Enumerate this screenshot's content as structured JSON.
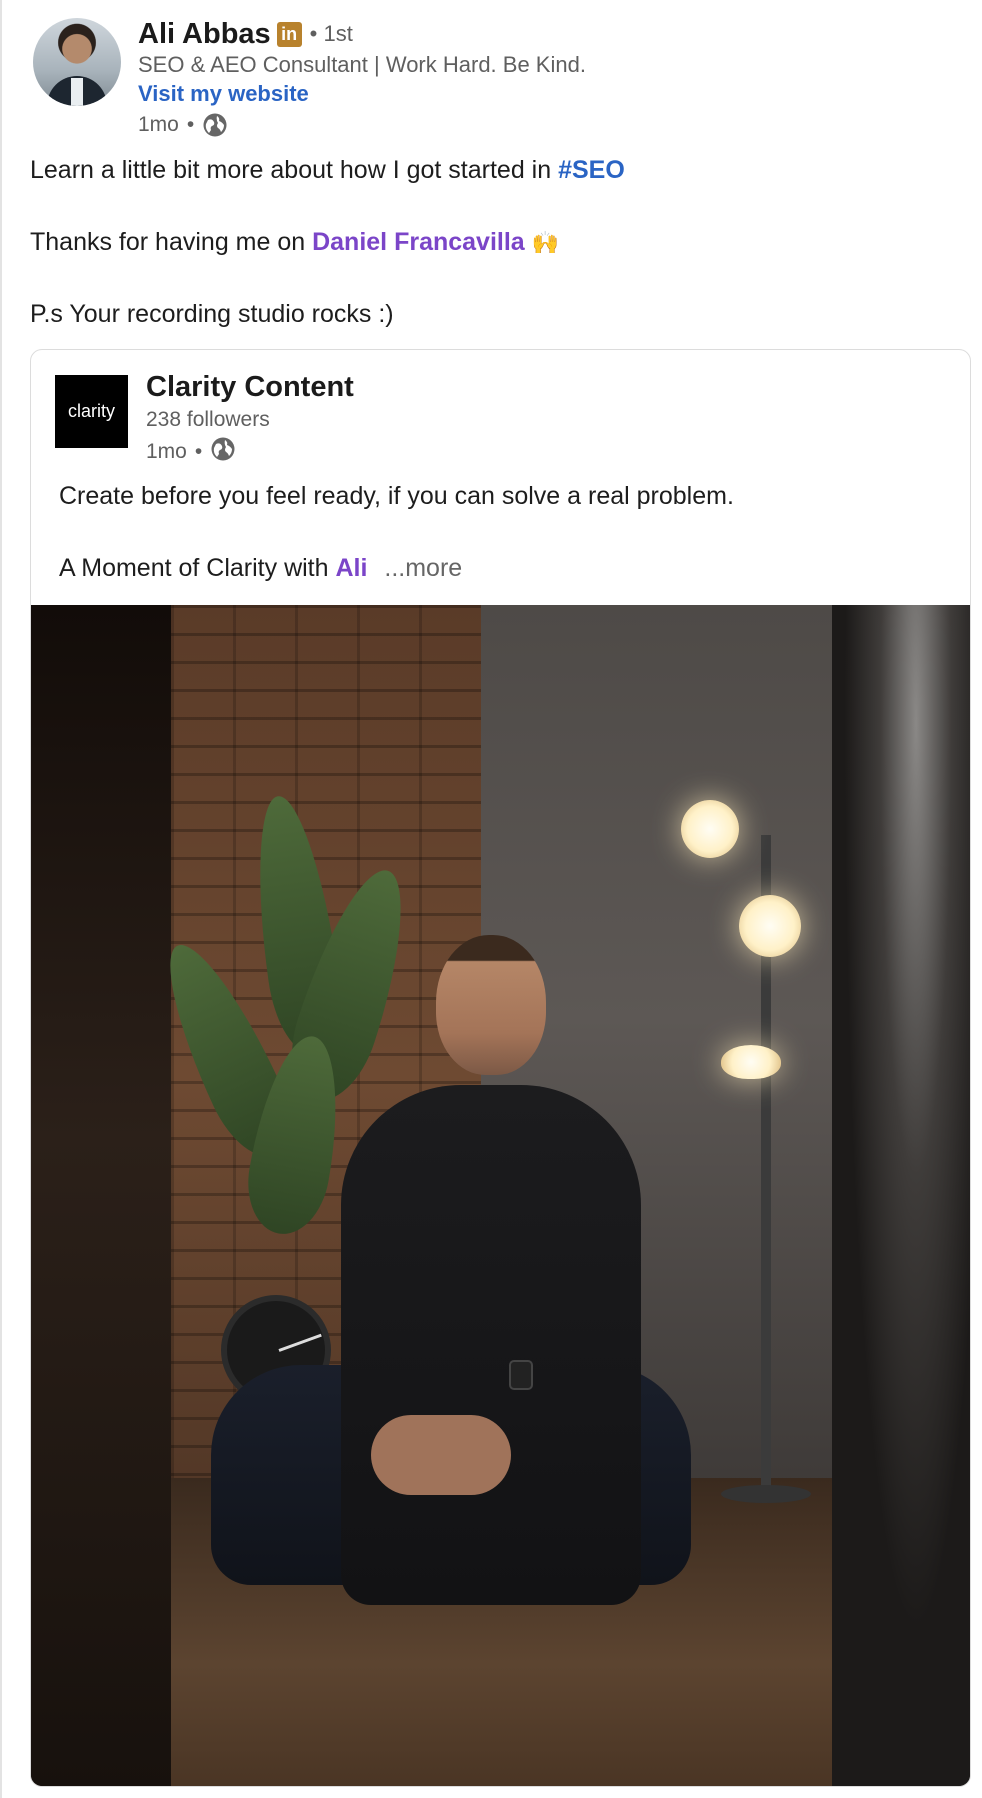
{
  "post": {
    "author": {
      "name": "Ali Abbas",
      "badge": "in",
      "degree": "• 1st",
      "headline": "SEO & AEO Consultant | Work Hard. Be Kind.",
      "website_label": "Visit my website",
      "time": "1mo",
      "dot": "•",
      "visibility_icon": "globe-icon"
    },
    "text": {
      "line1_prefix": "Learn a little bit more about how I got started in ",
      "hashtag": "#SEO",
      "line2_prefix": "Thanks for having me on ",
      "mention": "Daniel Francavilla",
      "emoji": "🙌",
      "line3": "P.s Your recording studio rocks :)"
    },
    "shared": {
      "company_logo_text": "clarity",
      "company_name": "Clarity Content",
      "followers": "238 followers",
      "time": "1mo",
      "dot": "•",
      "visibility_icon": "globe-icon",
      "line1": "Create before you feel ready, if you can solve a real problem.",
      "line2_prefix": "A Moment of Clarity with ",
      "mention": "Ali",
      "more_label": "...more"
    }
  },
  "colors": {
    "link_blue": "#2a64c4",
    "mention_purple": "#7b45c8",
    "badge_gold": "#b8822d",
    "secondary_text": "#5f5f5f"
  }
}
